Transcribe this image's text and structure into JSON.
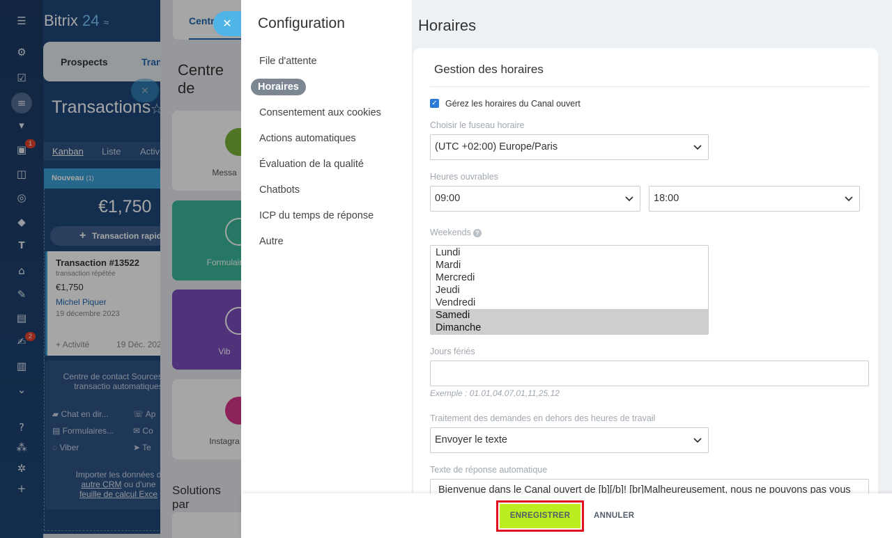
{
  "left_rail": {
    "badges": [
      "1",
      "2"
    ]
  },
  "crm": {
    "logo_main": "Bitrix",
    "logo_num": "24",
    "tabs": [
      "Prospects",
      "Tran"
    ],
    "title": "Transactions",
    "views": [
      "Kanban",
      "Liste",
      "Activ"
    ],
    "column": {
      "name": "Nouveau",
      "count": "(1)",
      "sum": "€1,750",
      "quick_add": "Transaction rapid"
    },
    "card": {
      "title": "Transaction #13522",
      "subtitle": "transaction répétée",
      "amount": "€1,750",
      "contact": "Michel Piquer",
      "date": "19 décembre 2023",
      "activity": "+ Activité",
      "activity_date": "19 Déc. 202"
    },
    "contact_center": {
      "title": "Centre de contact Sources de transactio automatiques",
      "sources": [
        "Chat en dir...",
        "Ap",
        "Formulaires...",
        "Co",
        "Viber",
        "Te"
      ],
      "import_prefix": "Importer les données d",
      "import_link1": "autre CRM",
      "import_mid": " ou d'une",
      "import_link2": "feuille de calcul Exce"
    }
  },
  "middle": {
    "tab": "Centr",
    "title": "Centre de",
    "tiles": [
      "Messa",
      "Formulair",
      "Vib",
      "Instagra"
    ],
    "solutions": "Solutions par"
  },
  "nav": {
    "title": "Configuration",
    "items": [
      "File d'attente",
      "Horaires",
      "Consentement aux cookies",
      "Actions automatiques",
      "Évaluation de la qualité",
      "Chatbots",
      "ICP du temps de réponse",
      "Autre"
    ]
  },
  "form": {
    "page_title": "Horaires",
    "section_title": "Gestion des horaires",
    "manage_label": "Gérez les horaires du Canal ouvert",
    "manage_checked": true,
    "timezone_label": "Choisir le fuseau horaire",
    "timezone_value": "(UTC +02:00) Europe/Paris",
    "hours_label": "Heures ouvrables",
    "hours_from": "09:00",
    "hours_to": "18:00",
    "weekends_label": "Weekends",
    "weekend_options": [
      {
        "label": "Lundi",
        "selected": false
      },
      {
        "label": "Mardi",
        "selected": false
      },
      {
        "label": "Mercredi",
        "selected": false
      },
      {
        "label": "Jeudi",
        "selected": false
      },
      {
        "label": "Vendredi",
        "selected": false
      },
      {
        "label": "Samedi",
        "selected": true
      },
      {
        "label": "Dimanche",
        "selected": true
      }
    ],
    "holidays_label": "Jours fériés",
    "holidays_value": "",
    "holidays_hint": "Exemple : 01.01,04.07,01,11,25.12",
    "offhours_label": "Traitement des demandes en dehors des heures de travail",
    "offhours_value": "Envoyer le texte",
    "autoreply_label": "Texte de réponse automatique",
    "autoreply_value": "Bienvenue dans le Canal ouvert de [b][/b]! [br]Malheureusement, nous ne pouvons pas vous"
  },
  "footer": {
    "save": "ENREGISTRER",
    "cancel": "ANNULER"
  },
  "colors": {
    "save_button": "#bbed21",
    "highlight": "#e0101e",
    "checkbox": "#2b7bd6"
  }
}
